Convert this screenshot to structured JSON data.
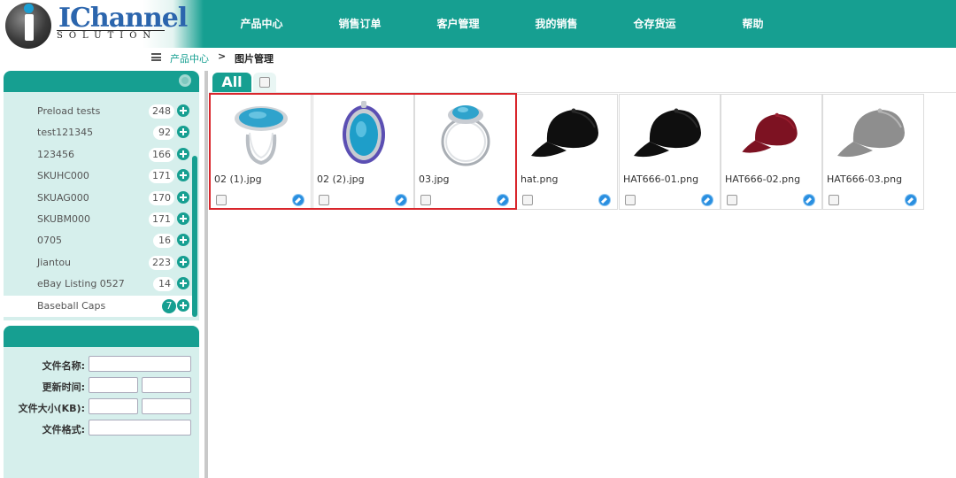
{
  "brand": {
    "logo_word": "IChannel",
    "logo_sub": "SOLUTION"
  },
  "nav": [
    {
      "label": "产品中心"
    },
    {
      "label": "销售订单"
    },
    {
      "label": "客户管理"
    },
    {
      "label": "我的销售"
    },
    {
      "label": "仓存货运"
    },
    {
      "label": "帮助"
    }
  ],
  "breadcrumb": {
    "parent": "产品中心",
    "separator": ">",
    "current": "图片管理"
  },
  "sidebar": {
    "groups": [
      {
        "name": "Preload tests",
        "count": "248"
      },
      {
        "name": "test121345",
        "count": "92"
      },
      {
        "name": "123456",
        "count": "166"
      },
      {
        "name": "SKUHC000",
        "count": "171"
      },
      {
        "name": "SKUAG000",
        "count": "170"
      },
      {
        "name": "SKUBM000",
        "count": "171"
      },
      {
        "name": "0705",
        "count": "16"
      },
      {
        "name": "Jiantou",
        "count": "223"
      },
      {
        "name": "eBay Listing 0527",
        "count": "14"
      },
      {
        "name": "Baseball Caps",
        "count": "7"
      }
    ],
    "active_group": "Baseball Caps"
  },
  "filters": {
    "file_name_label": "文件名称:",
    "update_time_label": "更新时间:",
    "file_size_label": "文件大小(KB):",
    "file_format_label": "文件格式:"
  },
  "tabs": {
    "all_label": "All"
  },
  "images": [
    {
      "name": "02 (1).jpg",
      "thumb": "ring-oval-turquoise"
    },
    {
      "name": "02 (2).jpg",
      "thumb": "turquoise-pendant"
    },
    {
      "name": "03.jpg",
      "thumb": "ring-turquoise-side"
    },
    {
      "name": "hat.png",
      "thumb": "cap-black"
    },
    {
      "name": "HAT666-01.png",
      "thumb": "cap-black"
    },
    {
      "name": "HAT666-02.png",
      "thumb": "cap-red"
    },
    {
      "name": "HAT666-03.png",
      "thumb": "cap-grey"
    }
  ],
  "colors": {
    "brand_teal": "#169f91",
    "panel_bg": "#d6efec",
    "selection_red": "#d9262c",
    "edit_blue": "#2a8fe0"
  }
}
